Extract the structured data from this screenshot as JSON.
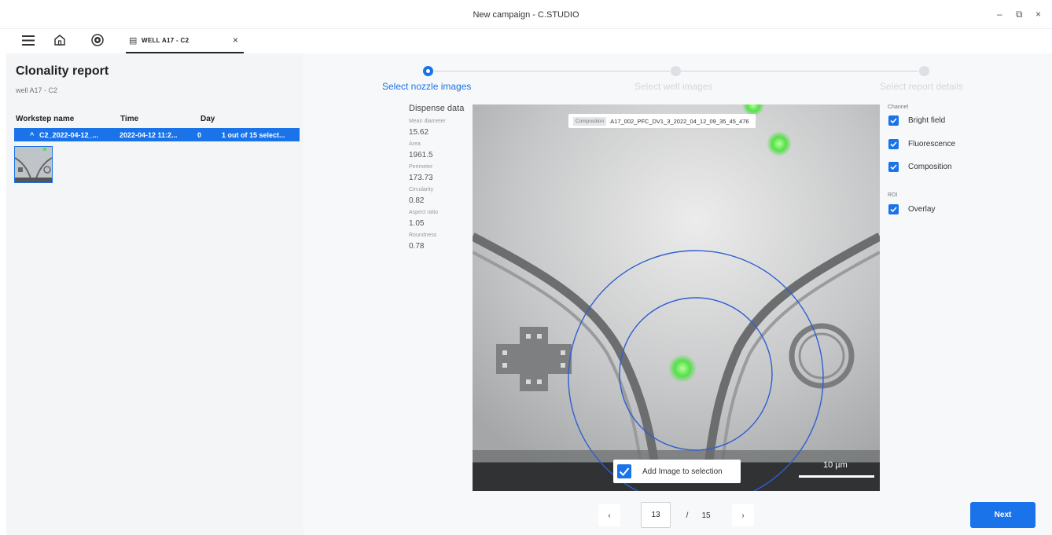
{
  "window": {
    "title": "New campaign - C.STUDIO",
    "minimize": "–",
    "restore": "⧉",
    "close": "×"
  },
  "tab": {
    "label": "WELL A17 - C2",
    "close": "×"
  },
  "sidebar": {
    "title": "Clonality report",
    "subtitle": "well A17 - C2",
    "columns": [
      "Workstep name",
      "Time",
      "Day"
    ],
    "row": {
      "expand": "^",
      "name": "C2_2022-04-12_...",
      "time": "2022-04-12 11:2...",
      "day": "0",
      "selection": "1 out of 15 select..."
    }
  },
  "steps": [
    {
      "label": "Select nozzle images",
      "active": true
    },
    {
      "label": "Select well images",
      "active": false
    },
    {
      "label": "Select report details",
      "active": false
    }
  ],
  "dispense": {
    "title": "Dispense data",
    "metrics": [
      {
        "label": "Mean diameter",
        "value": "15.62"
      },
      {
        "label": "Area",
        "value": "1961.5"
      },
      {
        "label": "Perimeter",
        "value": "173.73"
      },
      {
        "label": "Circularity",
        "value": "0.82"
      },
      {
        "label": "Aspect ratio",
        "value": "1.05"
      },
      {
        "label": "Roundness",
        "value": "0.78"
      }
    ]
  },
  "image": {
    "composition_tag": "Composition",
    "composition_name": "A17_002_PFC_DV1_3_2022_04_12_09_35_45_476",
    "add_label": "Add Image to selection",
    "add_checked": true,
    "scale": "10 µm"
  },
  "channel": {
    "heading": "Channel",
    "items": [
      {
        "label": "Bright field",
        "checked": true
      },
      {
        "label": "Fluorescence",
        "checked": true
      },
      {
        "label": "Composition",
        "checked": true
      }
    ]
  },
  "roi": {
    "heading": "ROI",
    "items": [
      {
        "label": "Overlay",
        "checked": true
      }
    ]
  },
  "pager": {
    "prev": "‹",
    "current": "13",
    "sep": "/",
    "total": "15",
    "next": "›"
  },
  "next_button": "Next",
  "colors": {
    "accent": "#1a73e8",
    "highlight": "#55e04a"
  }
}
